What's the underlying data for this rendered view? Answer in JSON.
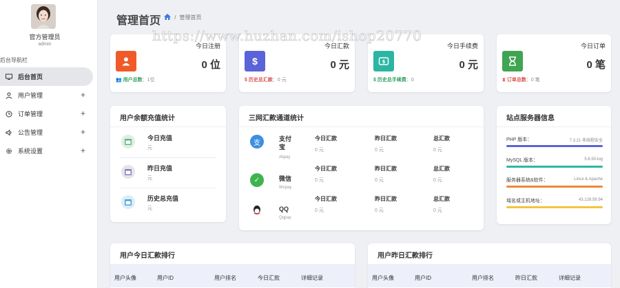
{
  "sidebar": {
    "user_name": "官方管理员",
    "user_role": "admin",
    "nav_header": "后台导航栏",
    "items": [
      {
        "label": "后台首页",
        "icon": "monitor-icon",
        "active": true
      },
      {
        "label": "用户管理",
        "icon": "user-icon",
        "expand": "+"
      },
      {
        "label": "订单管理",
        "icon": "clock-icon",
        "expand": "+"
      },
      {
        "label": "公告管理",
        "icon": "speaker-icon",
        "expand": "+"
      },
      {
        "label": "系统设置",
        "icon": "gear-icon",
        "expand": "+"
      }
    ]
  },
  "header": {
    "title": "管理首页",
    "separator": "/",
    "breadcrumb": "管理首页"
  },
  "watermark": "https://www.huzhan.com/ishop20770",
  "stats": [
    {
      "label": "今日注册",
      "value": "0 位",
      "foot_key": "用户总数",
      "foot_val": "：1位",
      "color": "#f05a28",
      "foot_color": "#2e9e5e",
      "glyph": "👤"
    },
    {
      "label": "今日汇款",
      "value": "0 元",
      "foot_key": "历史总汇款",
      "foot_val": "：0 元",
      "color": "#5a63d8",
      "foot_color": "#d9534f",
      "glyph": "$"
    },
    {
      "label": "今日手续费",
      "value": "0 元",
      "foot_key": "历史总手续费",
      "foot_val": "：0",
      "color": "#2bb6a3",
      "foot_color": "#2e9e5e",
      "glyph": "$"
    },
    {
      "label": "今日订单",
      "value": "0 笔",
      "foot_key": "订单总数",
      "foot_val": "：0 笔",
      "color": "#3fa552",
      "foot_color": "#d9534f",
      "glyph": "⧗"
    }
  ],
  "balance": {
    "title": "用户余额充值统计",
    "rows": [
      {
        "label": "今日充值",
        "value": "元"
      },
      {
        "label": "昨日充值",
        "value": "元"
      },
      {
        "label": "历史总充值",
        "value": "元"
      }
    ]
  },
  "channels": {
    "title": "三网汇款通道统计",
    "columns": [
      "今日汇款",
      "昨日汇款",
      "总汇款"
    ],
    "rows": [
      {
        "name": "支付宝",
        "sub": "Alipay",
        "values": [
          "0 元",
          "0 元",
          "0 元"
        ],
        "color": "#3d8fe0"
      },
      {
        "name": "微信",
        "sub": "Wxpay",
        "values": [
          "0 元",
          "0 元",
          "0 元"
        ],
        "color": "#3fb34f"
      },
      {
        "name": "QQ",
        "sub": "Qqpay",
        "values": [
          "0 元",
          "0 元",
          "0 元"
        ],
        "color": "#222222"
      }
    ]
  },
  "server": {
    "title": "站点服务器信息",
    "rows": [
      {
        "label": "PHP 版本：",
        "value": "7.3.21 非线程安全",
        "color": "#5a63d8"
      },
      {
        "label": "MySQL 版本：",
        "value": "5.6.50-log",
        "color": "#2bb6a3"
      },
      {
        "label": "服务器系统&软件：",
        "value": "Linux & Apache",
        "color": "#f0863c"
      },
      {
        "label": "域名或主机地址：",
        "value": "43.128.59.94",
        "color": "#f2c43a"
      }
    ]
  },
  "rank_today": {
    "title": "用户今日汇款排行",
    "columns": [
      "用户头像",
      "用户ID",
      "用户排名",
      "今日汇款",
      "详细记录"
    ]
  },
  "rank_yesterday": {
    "title": "用户昨日汇款排行",
    "columns": [
      "用户头像",
      "用户ID",
      "用户排名",
      "昨日汇款",
      "详细记录"
    ]
  }
}
